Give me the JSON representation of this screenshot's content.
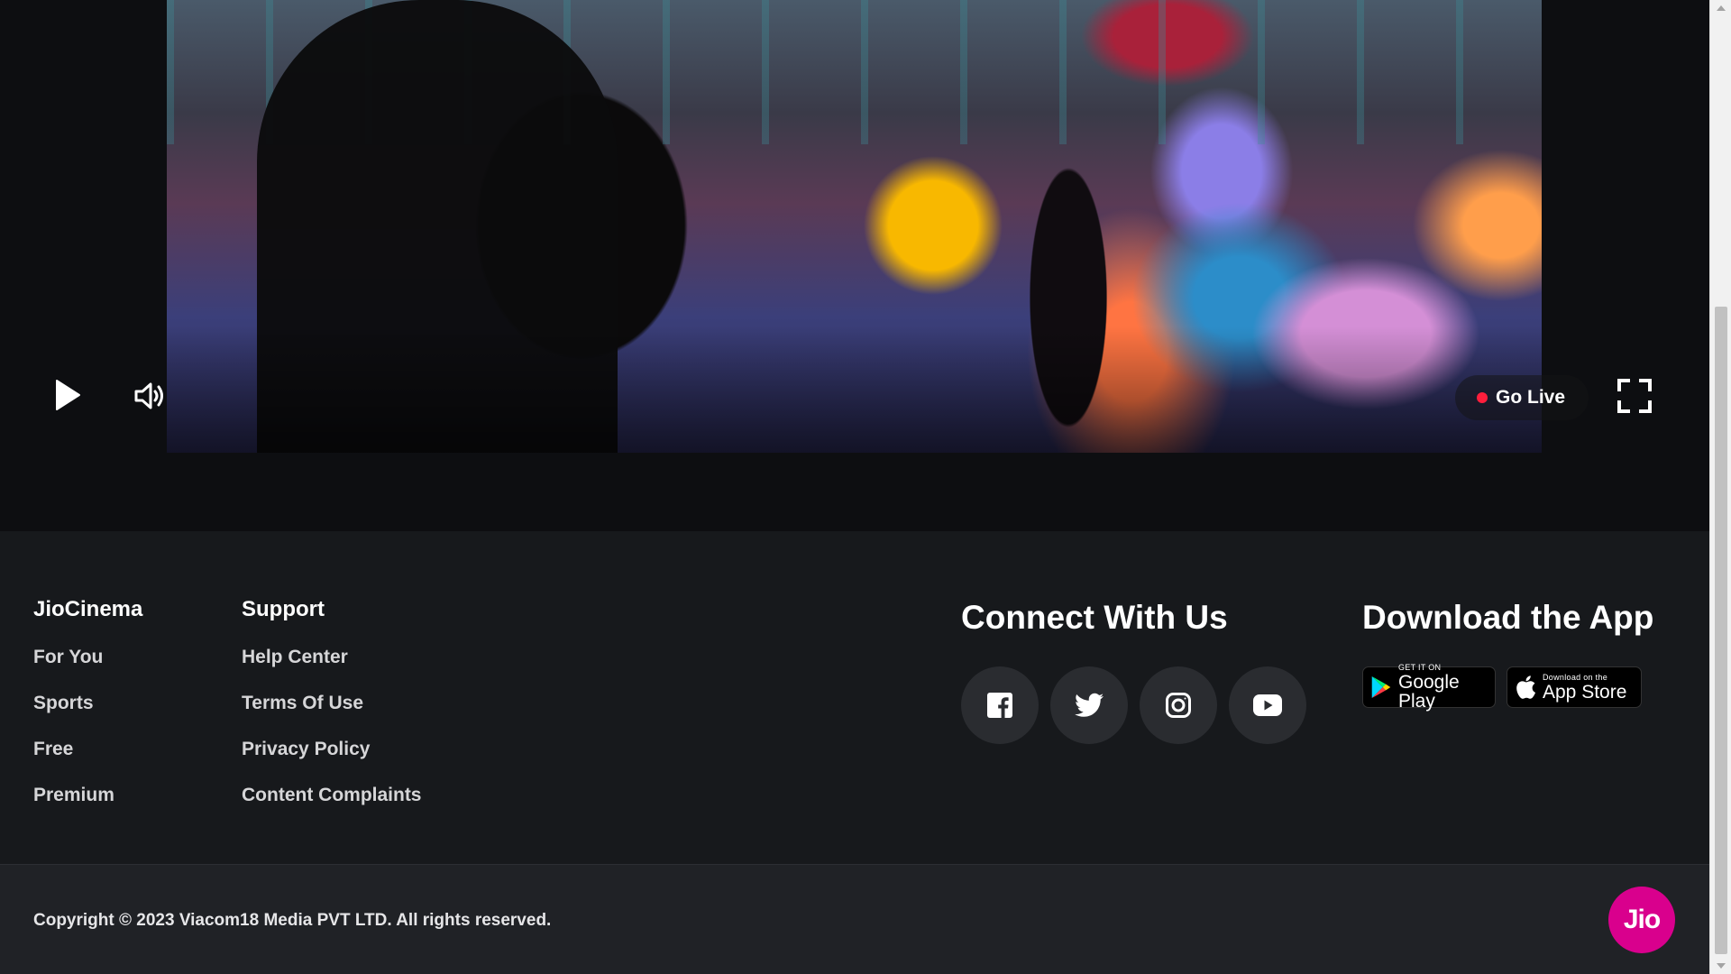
{
  "player": {
    "go_live_label": "Go Live",
    "play_icon": "play-icon",
    "volume_icon": "volume-icon",
    "fullscreen_icon": "fullscreen-icon",
    "live_dot_color": "#ff1e3c"
  },
  "footer": {
    "jiocinema": {
      "heading": "JioCinema",
      "links": [
        "For You",
        "Sports",
        "Free",
        "Premium"
      ]
    },
    "support": {
      "heading": "Support",
      "links": [
        "Help Center",
        "Terms Of Use",
        "Privacy Policy",
        "Content Complaints"
      ]
    },
    "connect": {
      "heading": "Connect With Us",
      "icons": [
        "facebook-icon",
        "twitter-icon",
        "instagram-icon",
        "youtube-icon"
      ]
    },
    "download": {
      "heading": "Download the App",
      "google_play": {
        "small": "GET IT ON",
        "big": "Google Play"
      },
      "app_store": {
        "small": "Download on the",
        "big": "App Store"
      }
    }
  },
  "bottom": {
    "copyright": "Copyright © 2023 Viacom18 Media PVT LTD. All rights reserved.",
    "logo_text": "Jio",
    "logo_color": "#d9008d"
  }
}
